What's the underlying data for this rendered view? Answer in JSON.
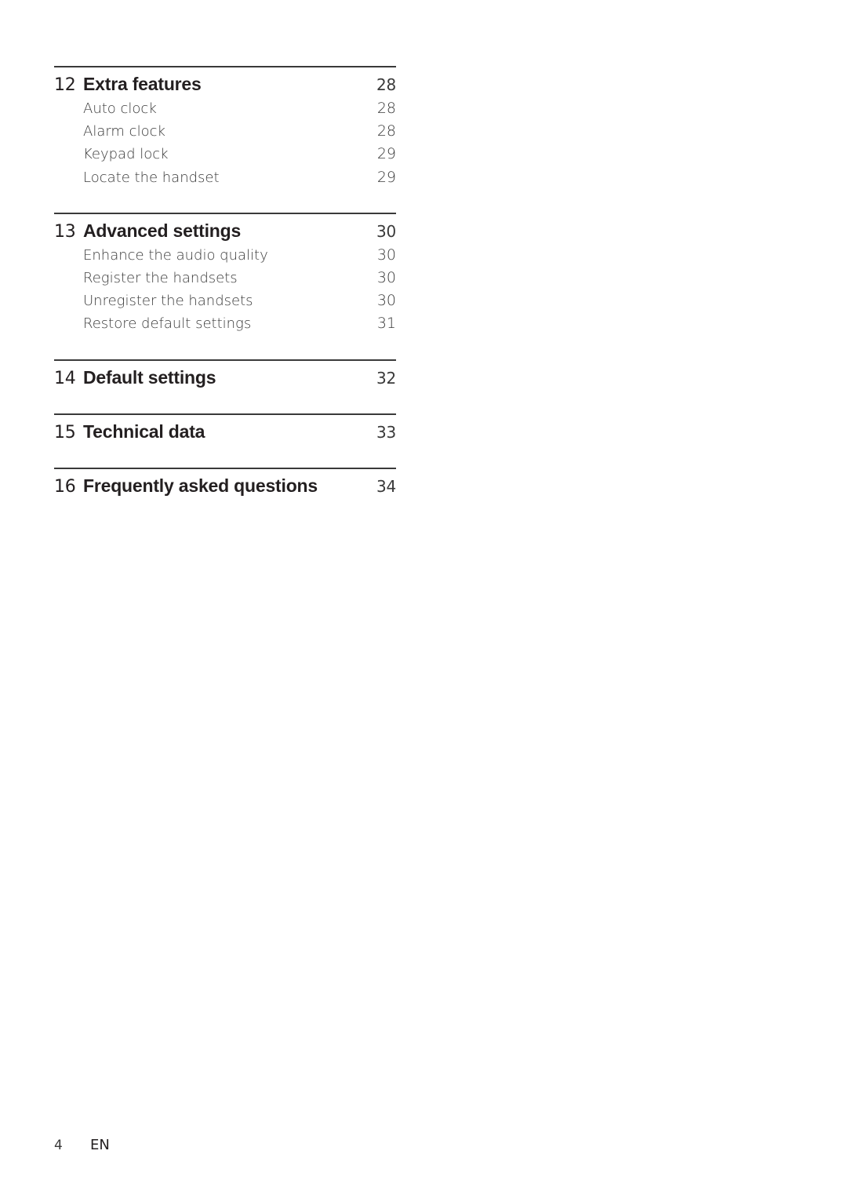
{
  "toc": {
    "sections": [
      {
        "number": "12",
        "title": "Extra features",
        "page": "28",
        "items": [
          {
            "label": "Auto clock",
            "page": "28"
          },
          {
            "label": "Alarm clock",
            "page": "28"
          },
          {
            "label": "Keypad lock",
            "page": "29"
          },
          {
            "label": "Locate the handset",
            "page": "29"
          }
        ]
      },
      {
        "number": "13",
        "title": "Advanced settings",
        "page": "30",
        "items": [
          {
            "label": "Enhance the audio quality",
            "page": "30"
          },
          {
            "label": "Register the handsets",
            "page": "30"
          },
          {
            "label": "Unregister the handsets",
            "page": "30"
          },
          {
            "label": "Restore default settings",
            "page": "31"
          }
        ]
      },
      {
        "number": "14",
        "title": "Default settings",
        "page": "32",
        "items": []
      },
      {
        "number": "15",
        "title": "Technical data",
        "page": "33",
        "items": []
      },
      {
        "number": "16",
        "title": "Frequently asked questions",
        "page": "34",
        "items": []
      }
    ]
  },
  "footer": {
    "page_number": "4",
    "language": "EN"
  }
}
